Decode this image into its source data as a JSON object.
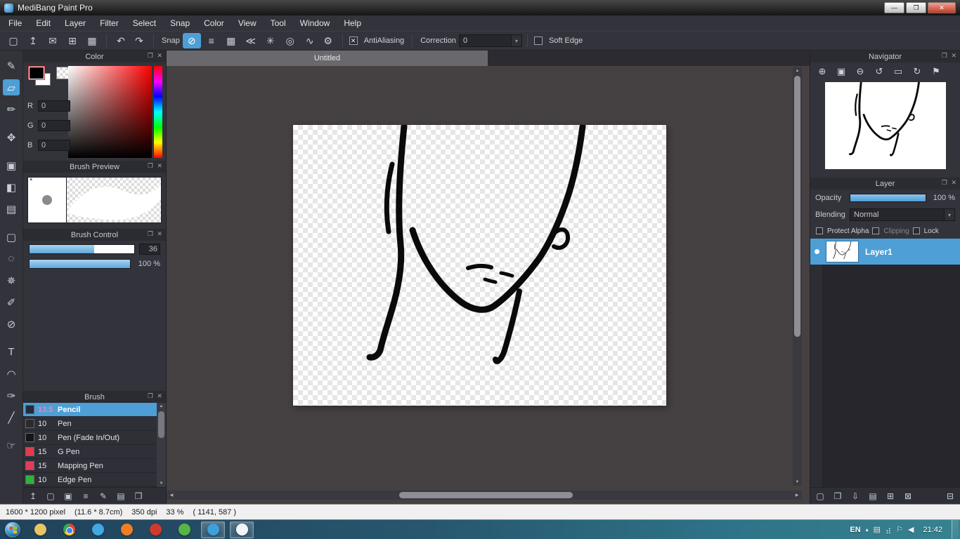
{
  "window": {
    "title": "MediBang Paint Pro",
    "controls": {
      "minimize": "—",
      "maximize": "❐",
      "close": "✕"
    }
  },
  "menu": {
    "items": [
      "File",
      "Edit",
      "Layer",
      "Filter",
      "Select",
      "Snap",
      "Color",
      "View",
      "Tool",
      "Window",
      "Help"
    ]
  },
  "icons": {
    "check": "✕",
    "caret_down": "▾",
    "popout": "❐",
    "close": "✕",
    "scroll_up": "▲",
    "scroll_down": "▼",
    "scroll_left": "◀",
    "scroll_right": "▶"
  },
  "toolbar": {
    "file_icons": [
      {
        "name": "new-canvas-icon",
        "glyph": "▢"
      },
      {
        "name": "cloud-upload-icon",
        "glyph": "↥"
      },
      {
        "name": "comment-icon",
        "glyph": "✉"
      },
      {
        "name": "pixel-grid-icon",
        "glyph": "⊞"
      },
      {
        "name": "materials-icon",
        "glyph": "▦"
      }
    ],
    "undo_icon": "↶",
    "redo_icon": "↷",
    "snap_label": "Snap",
    "snap_icons": [
      {
        "name": "snap-off-icon",
        "glyph": "⊘",
        "active": true
      },
      {
        "name": "snap-parallel-icon",
        "glyph": "≡"
      },
      {
        "name": "snap-grid-icon",
        "glyph": "▦"
      },
      {
        "name": "snap-vanishing-point-icon",
        "glyph": "≪"
      },
      {
        "name": "snap-radial-icon",
        "glyph": "✳"
      },
      {
        "name": "snap-concentric-icon",
        "glyph": "◎"
      },
      {
        "name": "snap-curve-icon",
        "glyph": "∿"
      }
    ],
    "settings_icon": "⚙",
    "antialiasing": {
      "label": "AntiAliasing",
      "checked": true
    },
    "correction": {
      "label": "Correction",
      "value": "0"
    },
    "soft_edge": {
      "label": "Soft Edge",
      "checked": false
    }
  },
  "tools": {
    "items": [
      {
        "name": "pen-tool",
        "glyph": "✎"
      },
      {
        "name": "eraser-tool",
        "glyph": "▱",
        "selected": true
      },
      {
        "name": "pencil-tool",
        "glyph": "✏"
      },
      {
        "name": "move-tool",
        "glyph": "✥",
        "gap": true
      },
      {
        "name": "shape-brush-tool",
        "glyph": "▣",
        "gap": true
      },
      {
        "name": "bucket-tool",
        "glyph": "◧"
      },
      {
        "name": "gradient-tool",
        "glyph": "▤"
      },
      {
        "name": "select-tool",
        "glyph": "▢",
        "gap": true
      },
      {
        "name": "lasso-tool",
        "glyph": "◌"
      },
      {
        "name": "magic-wand-tool",
        "glyph": "✵"
      },
      {
        "name": "select-pen-tool",
        "glyph": "✐"
      },
      {
        "name": "select-eraser-tool",
        "glyph": "⊘"
      },
      {
        "name": "text-tool",
        "glyph": "T",
        "gap": true
      },
      {
        "name": "operation-tool",
        "glyph": "◠"
      },
      {
        "name": "eyedropper-tool",
        "glyph": "✑"
      },
      {
        "name": "divide-tool",
        "glyph": "╱"
      },
      {
        "name": "hand-tool",
        "glyph": "☞",
        "gap": true
      }
    ]
  },
  "color_panel": {
    "title": "Color",
    "r_label": "R",
    "r_value": "0",
    "g_label": "G",
    "g_value": "0",
    "b_label": "B",
    "b_value": "0"
  },
  "brush_preview_panel": {
    "title": "Brush Preview",
    "marker": "*"
  },
  "brush_control_panel": {
    "title": "Brush Control",
    "size_value": "36",
    "size_percent": 62,
    "opacity_value": "100 %",
    "opacity_percent": 100
  },
  "brush_panel": {
    "title": "Brush",
    "items": [
      {
        "size": "13.5",
        "name": "Pencil",
        "swatch": "#252a3a",
        "selected": true
      },
      {
        "size": "10",
        "name": "Pen",
        "swatch": "#2b2b2b"
      },
      {
        "size": "10",
        "name": "Pen (Fade In/Out)",
        "swatch": "#151515"
      },
      {
        "size": "15",
        "name": "G Pen",
        "swatch": "#e03c4e"
      },
      {
        "size": "15",
        "name": "Mapping Pen",
        "swatch": "#e03c60"
      },
      {
        "size": "10",
        "name": "Edge Pen",
        "swatch": "#2eb33c"
      }
    ],
    "footer_icons": [
      {
        "name": "upload-brush-icon",
        "glyph": "↥"
      },
      {
        "name": "add-brush-icon",
        "glyph": "▢"
      },
      {
        "name": "add-brush-menu-icon",
        "glyph": "▣"
      },
      {
        "name": "brush-list-icon",
        "glyph": "≡"
      },
      {
        "name": "edit-brush-icon",
        "glyph": "✎"
      },
      {
        "name": "brush-folder-icon",
        "glyph": "▤"
      },
      {
        "name": "duplicate-brush-icon",
        "glyph": "❐"
      }
    ]
  },
  "document": {
    "tab_title": "Untitled"
  },
  "navigator": {
    "title": "Navigator",
    "icons": [
      {
        "name": "zoom-in-icon",
        "glyph": "⊕"
      },
      {
        "name": "fit-window-icon",
        "glyph": "▣"
      },
      {
        "name": "zoom-out-icon",
        "glyph": "⊖"
      },
      {
        "name": "rotate-ccw-icon",
        "glyph": "↺"
      },
      {
        "name": "actual-pixels-icon",
        "glyph": "▭"
      },
      {
        "name": "rotate-cw-icon",
        "glyph": "↻"
      },
      {
        "name": "reset-view-icon",
        "glyph": "⚑"
      }
    ]
  },
  "layer_panel": {
    "title": "Layer",
    "opacity_label": "Opacity",
    "opacity_value": "100 %",
    "opacity_percent": 100,
    "blending_label": "Blending",
    "blending_value": "Normal",
    "protect_alpha_label": "Protect Alpha",
    "clipping_label": "Clipping",
    "lock_label": "Lock",
    "layers": [
      {
        "name": "Layer1",
        "selected": true
      }
    ],
    "footer_icons": [
      {
        "name": "add-layer-icon",
        "glyph": "▢"
      },
      {
        "name": "duplicate-layer-icon",
        "glyph": "❐"
      },
      {
        "name": "transfer-layer-icon",
        "glyph": "⇩"
      },
      {
        "name": "layer-folder-icon",
        "glyph": "▤"
      },
      {
        "name": "merge-layer-icon",
        "glyph": "⊞"
      },
      {
        "name": "clear-layer-icon",
        "glyph": "⊠"
      }
    ],
    "delete_icon": {
      "name": "delete-layer-icon",
      "glyph": "⊟"
    }
  },
  "status_bar": {
    "size": "1600 * 1200 pixel",
    "print_size": "(11.6 * 8.7cm)",
    "dpi": "350 dpi",
    "zoom": "33 %",
    "cursor": "( 1141, 587 )"
  },
  "taskbar": {
    "language": "EN",
    "time": "21:42",
    "hidden_icons_glyph": "▴",
    "apps": [
      {
        "name": "taskbar-explorer",
        "color": "#e9c463",
        "open": false
      },
      {
        "name": "taskbar-chrome",
        "color": "chrome",
        "open": false
      },
      {
        "name": "taskbar-qq",
        "color": "#41a8e1",
        "open": false
      },
      {
        "name": "taskbar-firefox",
        "color": "#f07f23",
        "open": false
      },
      {
        "name": "taskbar-app-red",
        "color": "#cf3a2f",
        "open": false
      },
      {
        "name": "taskbar-app-green",
        "color": "#57b547",
        "open": false
      },
      {
        "name": "taskbar-chat",
        "color": "#3f9fdd",
        "open": true
      },
      {
        "name": "taskbar-medibang",
        "color": "#f2f6f8",
        "open": true
      }
    ],
    "tray_icons": [
      {
        "name": "action-center-icon",
        "glyph": "▤"
      },
      {
        "name": "network-icon",
        "glyph": "⣴"
      },
      {
        "name": "flag-icon",
        "glyph": "⚐"
      },
      {
        "name": "volume-icon",
        "glyph": "◀"
      }
    ]
  },
  "colors": {
    "accent": "#4d9fd6",
    "panel_bg": "#33333b",
    "canvas_bg": "#464142",
    "statusbar_bg": "#f0f0f0",
    "close_button": "#c23a28"
  }
}
